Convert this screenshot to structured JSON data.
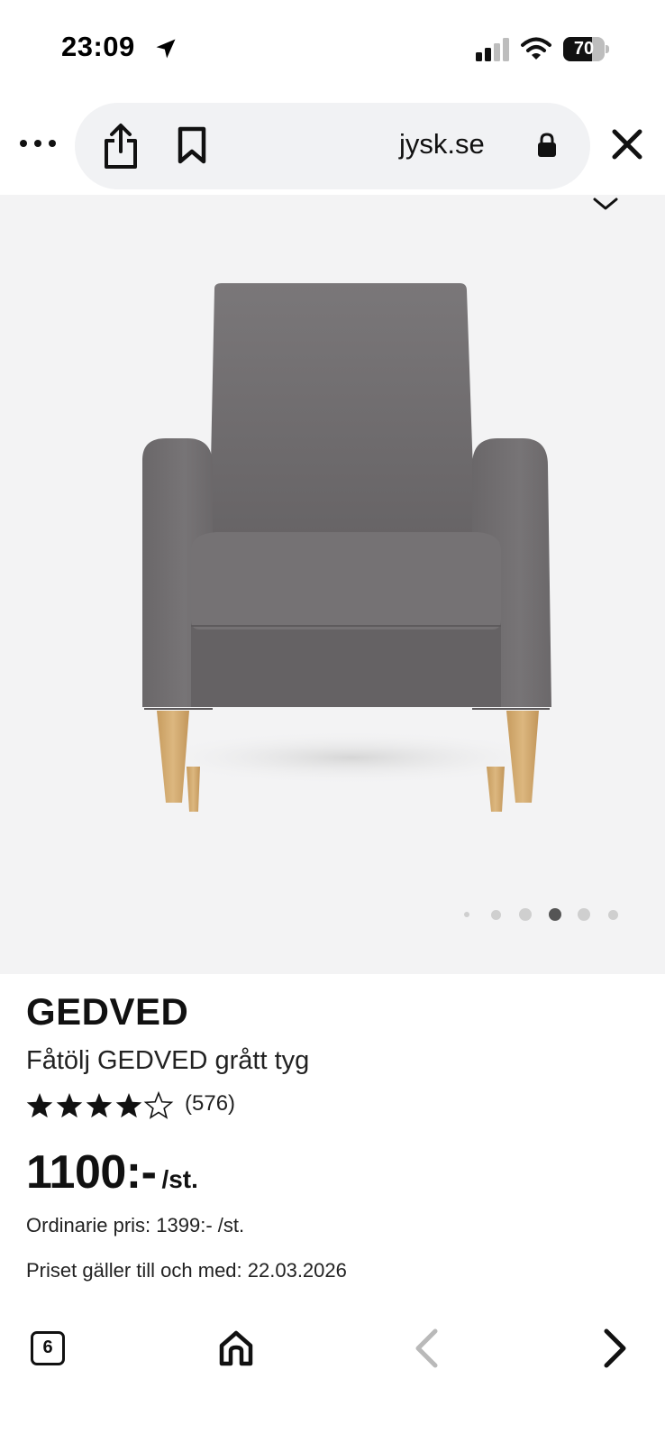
{
  "status_bar": {
    "time": "23:09",
    "battery": "70",
    "battery_level": 0.7,
    "icons": [
      "location-arrow-icon",
      "signal-icon",
      "wifi-icon",
      "battery-icon"
    ]
  },
  "browser": {
    "domain": "jysk.se",
    "icons": [
      "more-icon",
      "share-icon",
      "bookmark-icon",
      "lock-icon",
      "close-icon"
    ]
  },
  "gallery": {
    "image_alt": "Fåtölj GEDVED grått tyg",
    "dot_count": 6,
    "active_dot": 4
  },
  "product": {
    "brand": "GEDVED",
    "title": "Fåtölj GEDVED grått tyg",
    "rating_stars": 4,
    "rating_max": 5,
    "review_count": "(576)",
    "price": "1100:-",
    "unit": "/st.",
    "ordinary_price": "Ordinarie pris: 1399:- /st.",
    "price_valid": "Priset gäller till och med: 22.03.2026"
  },
  "bottom_nav": {
    "tab_count": "6",
    "icons": [
      "tabs-icon",
      "home-icon",
      "back-arrow-icon",
      "forward-arrow-icon"
    ]
  },
  "colors": {
    "text": "#111111",
    "gallery_bg": "#f3f3f4",
    "pill_bg": "#f1f2f4",
    "fabric": "#6f6c6e",
    "wood": "#d2ac73",
    "dot_active": "#555555",
    "dot_inactive": "#cfcfcf",
    "disabled": "#b9b9b9"
  }
}
